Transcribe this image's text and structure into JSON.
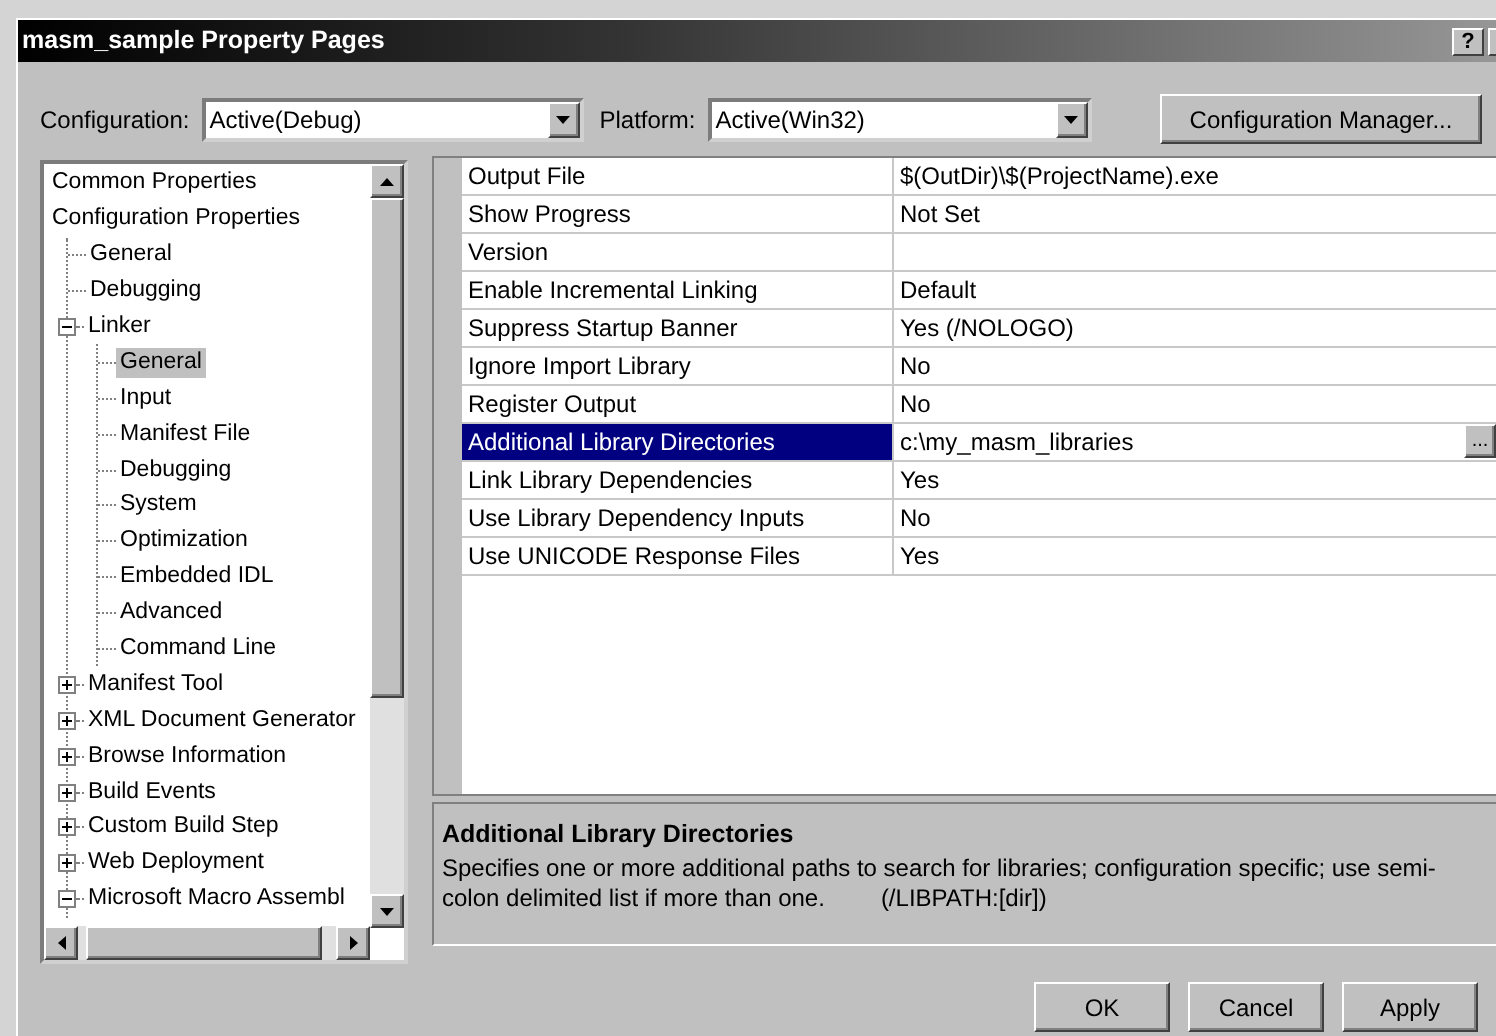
{
  "window": {
    "title": "masm_sample Property Pages",
    "help_button": "?"
  },
  "configuration": {
    "label": "Configuration:",
    "value": "Active(Debug)"
  },
  "platform": {
    "label": "Platform:",
    "value": "Active(Win32)"
  },
  "configuration_manager_button": "Configuration Manager...",
  "tree": [
    {
      "label": "Common Properties",
      "selected": false
    },
    {
      "label": "Configuration Properties",
      "selected": false,
      "children": [
        {
          "label": "General",
          "selected": false
        },
        {
          "label": "Debugging",
          "selected": false
        },
        {
          "label": "Linker",
          "selected": false,
          "expanded": true,
          "children": [
            {
              "label": "General",
              "selected": true
            },
            {
              "label": "Input",
              "selected": false
            },
            {
              "label": "Manifest File",
              "selected": false
            },
            {
              "label": "Debugging",
              "selected": false
            },
            {
              "label": "System",
              "selected": false
            },
            {
              "label": "Optimization",
              "selected": false
            },
            {
              "label": "Embedded IDL",
              "selected": false
            },
            {
              "label": "Advanced",
              "selected": false
            },
            {
              "label": "Command Line",
              "selected": false
            }
          ]
        },
        {
          "label": "Manifest Tool",
          "selected": false,
          "expanded": false
        },
        {
          "label": "XML Document Generator",
          "selected": false,
          "expanded": false
        },
        {
          "label": "Browse Information",
          "selected": false,
          "expanded": false
        },
        {
          "label": "Build Events",
          "selected": false,
          "expanded": false
        },
        {
          "label": "Custom Build Step",
          "selected": false,
          "expanded": false
        },
        {
          "label": "Web Deployment",
          "selected": false,
          "expanded": false
        },
        {
          "label": "Microsoft Macro Assembl",
          "selected": false,
          "expanded": true
        }
      ]
    }
  ],
  "properties": [
    {
      "name": "Output File",
      "value": "$(OutDir)\\$(ProjectName).exe",
      "selected": false
    },
    {
      "name": "Show Progress",
      "value": "Not Set",
      "selected": false
    },
    {
      "name": "Version",
      "selected": false
    },
    {
      "name": "Enable Incremental Linking",
      "value": "Default",
      "selected": false
    },
    {
      "name": "Suppress Startup Banner",
      "value": "Yes (/NOLOGO)",
      "selected": false
    },
    {
      "name": "Ignore Import Library",
      "value": "No",
      "selected": false
    },
    {
      "name": "Register Output",
      "value": "No",
      "selected": false
    },
    {
      "name": "Additional Library Directories",
      "value": "c:\\my_masm_libraries",
      "selected": true,
      "button": "..."
    },
    {
      "name": "Link Library Dependencies",
      "value": "Yes",
      "selected": false
    },
    {
      "name": "Use Library Dependency Inputs",
      "value": "No",
      "selected": false
    },
    {
      "name": "Use UNICODE Response Files",
      "value": "Yes",
      "selected": false
    }
  ],
  "description": {
    "title": "Additional Library Directories",
    "text": "Specifies one or more additional paths to search for libraries; configuration specific; use semi-colon delimited list if more than one.",
    "switch": "(/LIBPATH:[dir])"
  },
  "buttons": [
    "OK",
    "Cancel",
    "Apply"
  ]
}
